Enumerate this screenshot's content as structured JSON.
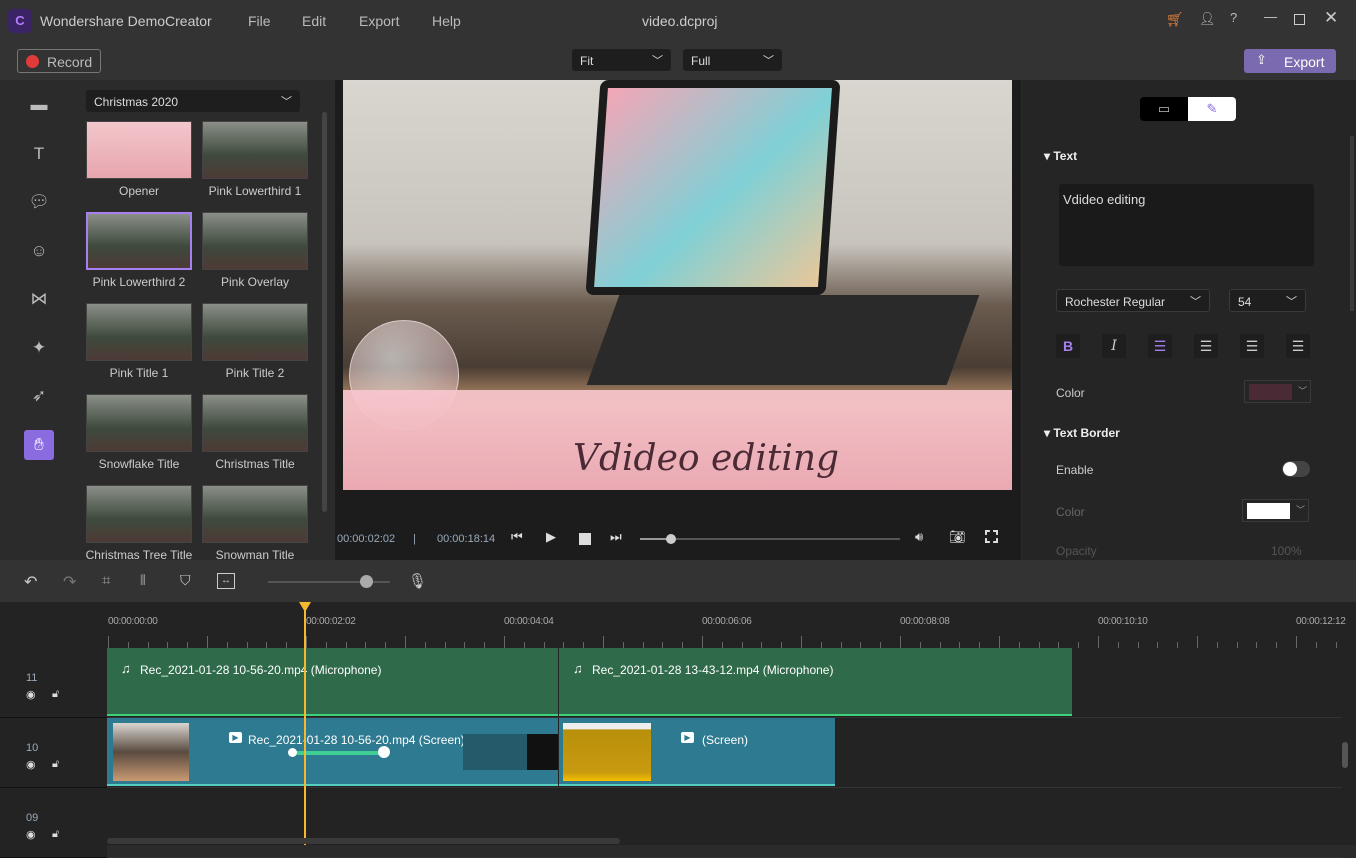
{
  "app": {
    "name": "Wondershare DemoCreator",
    "document_title": "video.dcproj",
    "menu": [
      "File",
      "Edit",
      "Export",
      "Help"
    ],
    "accent": "#8a6be0"
  },
  "toolbar": {
    "record_label": "Record",
    "zoom_select": "Fit",
    "quality_select": "Full",
    "export_label": "Export"
  },
  "sidebar": {
    "icons": [
      "folder-icon",
      "text-icon",
      "annotation-icon",
      "sticker-icon",
      "transition-icon",
      "effects-icon",
      "cursor-icon",
      "captions-icon"
    ]
  },
  "library": {
    "category": "Christmas 2020",
    "items": [
      {
        "label": "Opener",
        "style": "pink",
        "selected": false
      },
      {
        "label": "Pink Lowerthird 1",
        "style": "photo",
        "selected": false
      },
      {
        "label": "Pink Lowerthird 2",
        "style": "photo",
        "selected": true
      },
      {
        "label": "Pink Overlay",
        "style": "photo",
        "selected": false
      },
      {
        "label": "Pink Title 1",
        "style": "photo",
        "selected": false
      },
      {
        "label": "Pink Title 2",
        "style": "photo",
        "selected": false
      },
      {
        "label": "Snowflake Title",
        "style": "photo",
        "selected": false
      },
      {
        "label": "Christmas Title",
        "style": "photo",
        "selected": false
      },
      {
        "label": "Christmas Tree Title",
        "style": "photo",
        "selected": false
      },
      {
        "label": "Snowman Title",
        "style": "photo",
        "selected": false
      }
    ]
  },
  "preview": {
    "caption": "Vdideo editing",
    "current_time": "00:00:02:02",
    "total_time": "00:00:18:14",
    "progress": 0.12
  },
  "properties": {
    "text_section": "Text",
    "text_value": "Vdideo editing",
    "font": "Rochester Regular",
    "size": "54",
    "color_label": "Color",
    "text_color": "#4a2a35",
    "border_section": "Text Border",
    "enable_label": "Enable",
    "enable_on": false,
    "border_color_label": "Color",
    "border_color": "#ffffff",
    "opacity_label": "Opacity",
    "opacity_value": "100%"
  },
  "timeline": {
    "zoom_level": 0.8,
    "ticks": [
      "00:00:00:00",
      "00:00:02:02",
      "00:00:04:04",
      "00:00:06:06",
      "00:00:08:08",
      "00:00:10:10",
      "00:00:12:12"
    ],
    "tracks": [
      {
        "id": "11",
        "clips": [
          "Rec_2021-01-28 10-56-20.mp4 (Microphone)",
          "Rec_2021-01-28 13-43-12.mp4 (Microphone)"
        ]
      },
      {
        "id": "10",
        "clips": [
          "Rec_2021-01-28 10-56-20.mp4 (Screen)",
          "(Screen)"
        ]
      },
      {
        "id": "09",
        "clips": []
      }
    ]
  }
}
